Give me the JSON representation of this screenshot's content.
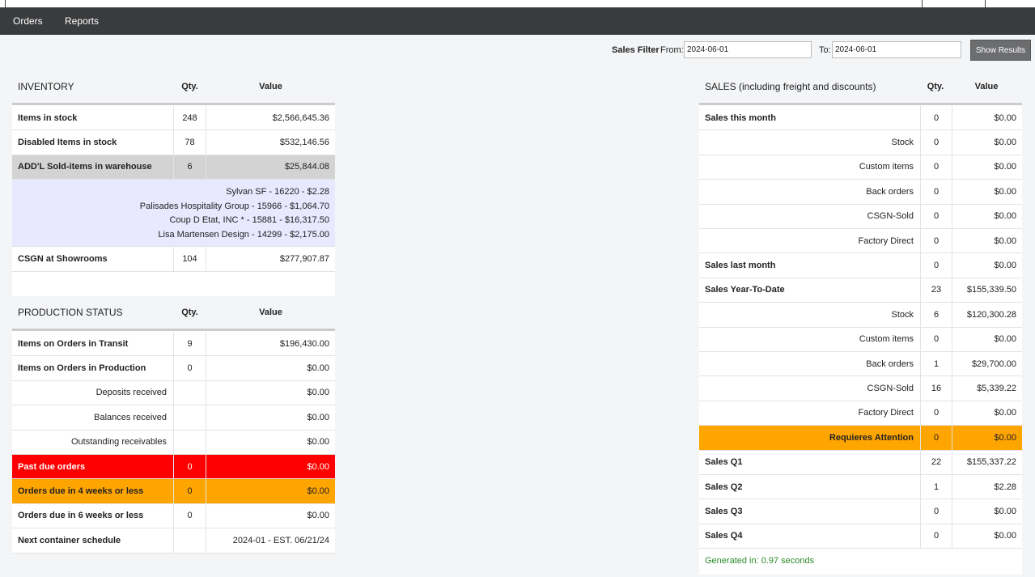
{
  "nav": {
    "orders": "Orders",
    "reports": "Reports"
  },
  "filter": {
    "title": "Sales Filter",
    "from_label": "From:",
    "from_value": "2024-06-01",
    "to_label": "To:",
    "to_value": "2024-06-01",
    "button": "Show Results"
  },
  "inventory": {
    "title": "INVENTORY",
    "qty_header": "Qty.",
    "value_header": "Value",
    "rows": [
      {
        "label": "Items in stock",
        "qty": "248",
        "value": "$2,566,645.36"
      },
      {
        "label": "Disabled Items in stock",
        "qty": "78",
        "value": "$532,146.56"
      },
      {
        "label": "ADD'L Sold-items in warehouse",
        "qty": "6",
        "value": "$25,844.08"
      }
    ],
    "notes": [
      "Sylvan SF - 16220 - $2.28",
      "Palisades Hospitality Group - 15966 - $1,064.70",
      "Coup D Etat, INC * - 15881 - $16,317.50",
      "Lisa Martensen Design - 14299 - $2,175.00"
    ],
    "csgn": {
      "label": "CSGN at Showrooms",
      "qty": "104",
      "value": "$277,907.87"
    }
  },
  "production": {
    "title": "PRODUCTION STATUS",
    "qty_header": "Qty.",
    "value_header": "Value",
    "rows": [
      {
        "label": "Items on Orders in Transit",
        "qty": "9",
        "value": "$196,430.00"
      },
      {
        "label": "Items on Orders in Production",
        "qty": "0",
        "value": "$0.00"
      },
      {
        "label": "Deposits received",
        "qty": "",
        "value": "$0.00"
      },
      {
        "label": "Balances received",
        "qty": "",
        "value": "$0.00"
      },
      {
        "label": "Outstanding receivables",
        "qty": "",
        "value": "$0.00"
      },
      {
        "label": "Past due orders",
        "qty": "0",
        "value": "$0.00"
      },
      {
        "label": "Orders due in 4 weeks or less",
        "qty": "0",
        "value": "$0.00"
      },
      {
        "label": "Orders due in 6 weeks or less",
        "qty": "0",
        "value": "$0.00"
      },
      {
        "label": "Next container schedule",
        "qty": "",
        "value": "2024-01 - EST. 06/21/24"
      }
    ]
  },
  "sales": {
    "title": "SALES (including freight and discounts)",
    "qty_header": "Qty.",
    "value_header": "Value",
    "rows": [
      {
        "label": "Sales this month",
        "qty": "0",
        "value": "$0.00"
      },
      {
        "label": "Stock",
        "qty": "0",
        "value": "$0.00"
      },
      {
        "label": "Custom items",
        "qty": "0",
        "value": "$0.00"
      },
      {
        "label": "Back orders",
        "qty": "0",
        "value": "$0.00"
      },
      {
        "label": "CSGN-Sold",
        "qty": "0",
        "value": "$0.00"
      },
      {
        "label": "Factory Direct",
        "qty": "0",
        "value": "$0.00"
      },
      {
        "label": "Sales last month",
        "qty": "0",
        "value": "$0.00"
      },
      {
        "label": "Sales Year-To-Date",
        "qty": "23",
        "value": "$155,339.50"
      },
      {
        "label": "Stock",
        "qty": "6",
        "value": "$120,300.28"
      },
      {
        "label": "Custom items",
        "qty": "0",
        "value": "$0.00"
      },
      {
        "label": "Back orders",
        "qty": "1",
        "value": "$29,700.00"
      },
      {
        "label": "CSGN-Sold",
        "qty": "16",
        "value": "$5,339.22"
      },
      {
        "label": "Factory Direct",
        "qty": "0",
        "value": "$0.00"
      },
      {
        "label": "Requieres Attention",
        "qty": "0",
        "value": "$0.00"
      },
      {
        "label": "Sales Q1",
        "qty": "22",
        "value": "$155,337.22"
      },
      {
        "label": "Sales Q2",
        "qty": "1",
        "value": "$2.28"
      },
      {
        "label": "Sales Q3",
        "qty": "0",
        "value": "$0.00"
      },
      {
        "label": "Sales Q4",
        "qty": "0",
        "value": "$0.00"
      }
    ]
  },
  "footer": {
    "generated": "Generated in: 0.97 seconds"
  },
  "colors": {
    "navbar": "#3a3b3d",
    "past_due": "#ff0000",
    "warning": "#ffa500",
    "gray_row": "#d3d3d3",
    "note_bg": "#e8e8ff",
    "generated_text": "#2a8a2a"
  }
}
